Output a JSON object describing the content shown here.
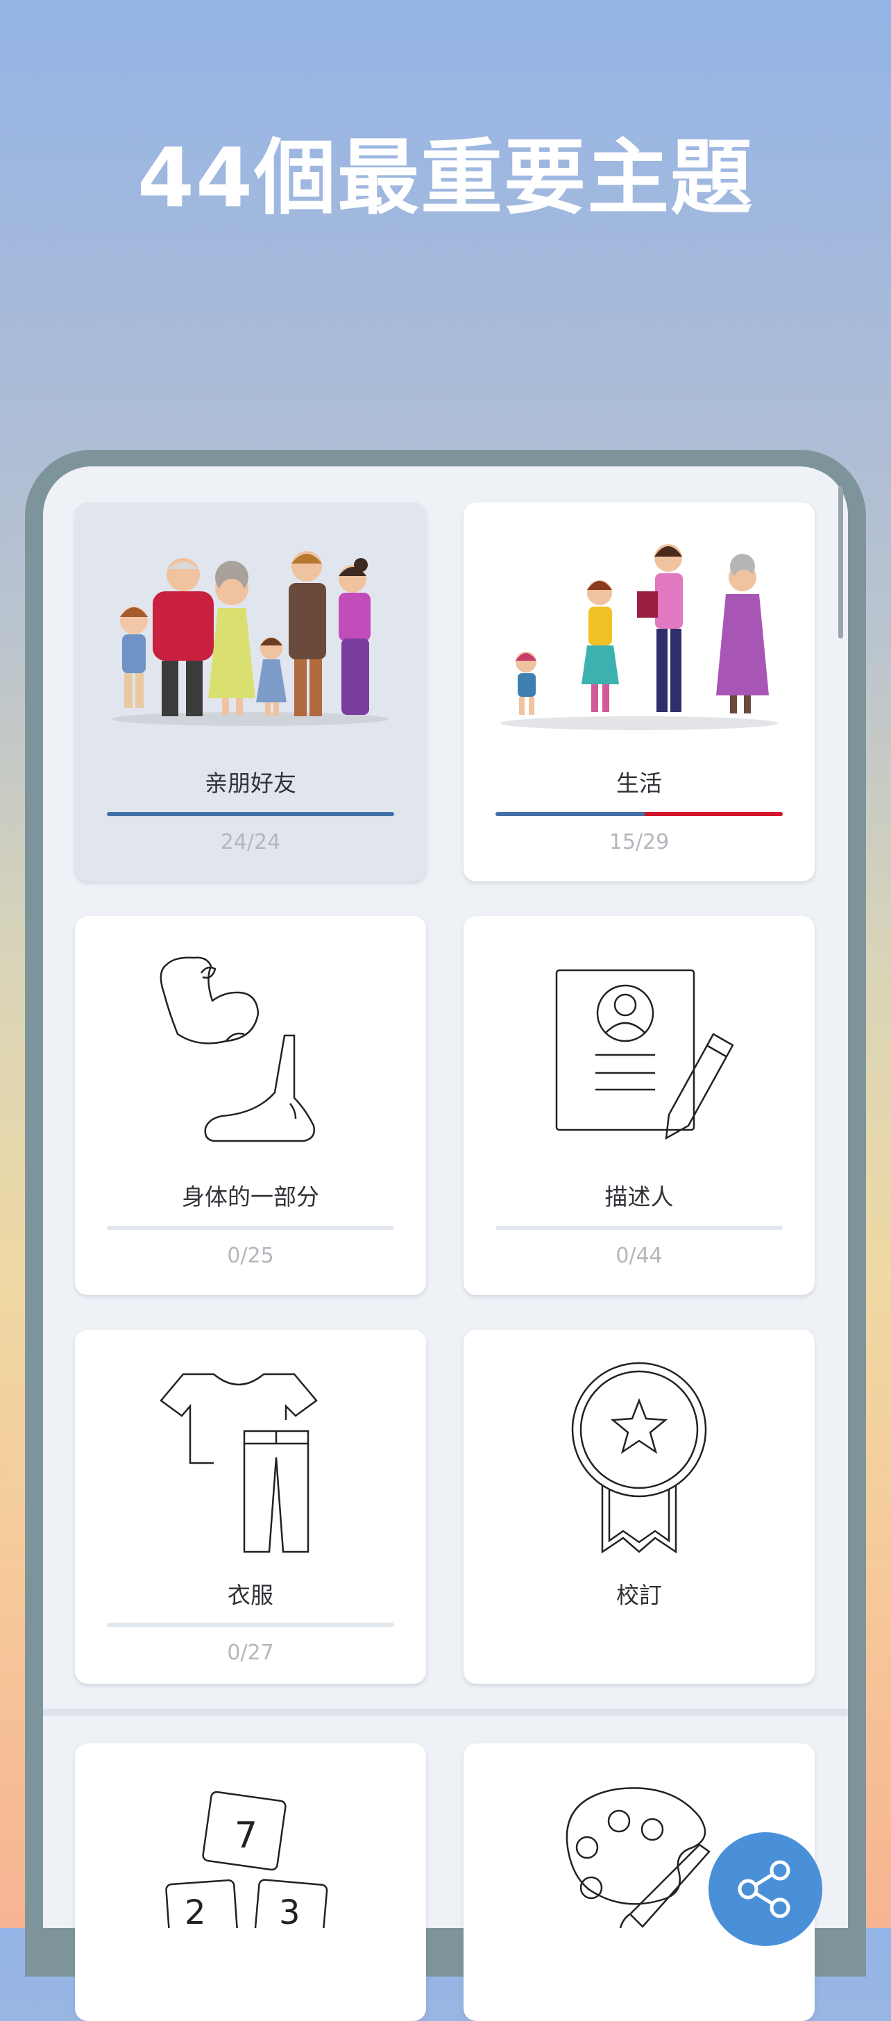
{
  "headline": "44個最重要主題",
  "colors": {
    "progress_done": "#4270a9",
    "progress_wrong": "#d3142c",
    "fab": "#4a90d9"
  },
  "topics": [
    {
      "title": "亲朋好友",
      "count": "24/24",
      "progress": 1.0,
      "wrong": 0,
      "selected": true,
      "icon": "family-illustration"
    },
    {
      "title": "生活",
      "count": "15/29",
      "progress": 0.52,
      "wrong": 0.48,
      "selected": false,
      "icon": "life-stages-illustration"
    },
    {
      "title": "身体的一部分",
      "count": "0/25",
      "progress": 0,
      "wrong": 0,
      "icon": "body-parts-icon"
    },
    {
      "title": "描述人",
      "count": "0/44",
      "progress": 0,
      "wrong": 0,
      "icon": "profile-document-icon"
    },
    {
      "title": "衣服",
      "count": "0/27",
      "progress": 0,
      "wrong": 0,
      "icon": "clothes-icon"
    },
    {
      "title": "校訂",
      "count": "",
      "icon": "medal-icon"
    },
    {
      "title": "",
      "count": "",
      "icon": "number-blocks-icon"
    },
    {
      "title": "",
      "count": "",
      "icon": "palette-icon"
    }
  ],
  "fab": {
    "icon": "share-icon"
  }
}
